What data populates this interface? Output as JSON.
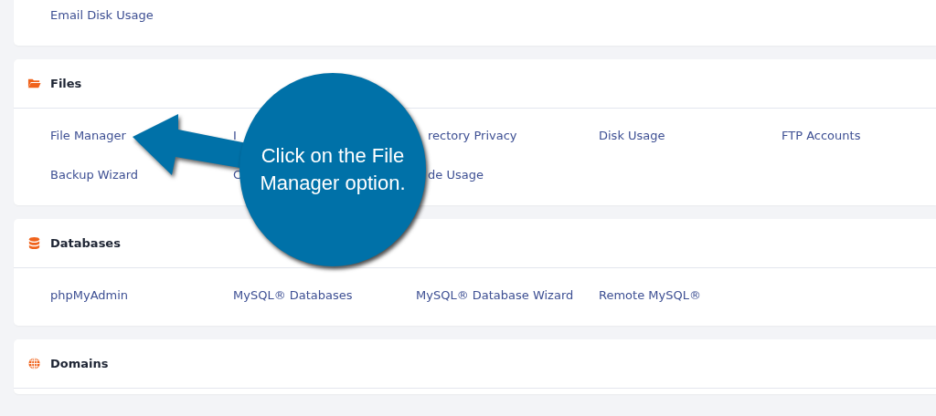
{
  "sections": [
    {
      "items": [
        {
          "label": "Email Disk Usage",
          "kind": "link"
        }
      ]
    },
    {
      "title": "Files",
      "items": [
        {
          "label": "File Manager",
          "kind": "link"
        },
        {
          "label": "I",
          "kind": "link"
        },
        {
          "label": "rectory Privacy",
          "kind": "partly-covered"
        },
        {
          "label": "Disk Usage",
          "kind": "link"
        },
        {
          "label": "FTP Accounts",
          "kind": "link"
        },
        {
          "label": "Backup Wizard",
          "kind": "link"
        },
        {
          "label": "C",
          "kind": "link"
        },
        {
          "label": "de Usage",
          "kind": "partly-covered"
        }
      ]
    },
    {
      "title": "Databases",
      "items": [
        {
          "label": "phpMyAdmin",
          "kind": "link"
        },
        {
          "label": "MySQL® Databases",
          "kind": "link"
        },
        {
          "label": "MySQL® Database Wizard",
          "kind": "link"
        },
        {
          "label": "Remote MySQL®",
          "kind": "link"
        }
      ]
    },
    {
      "title": "Domains"
    }
  ],
  "callout": {
    "text": "Click on the File Manager option."
  }
}
